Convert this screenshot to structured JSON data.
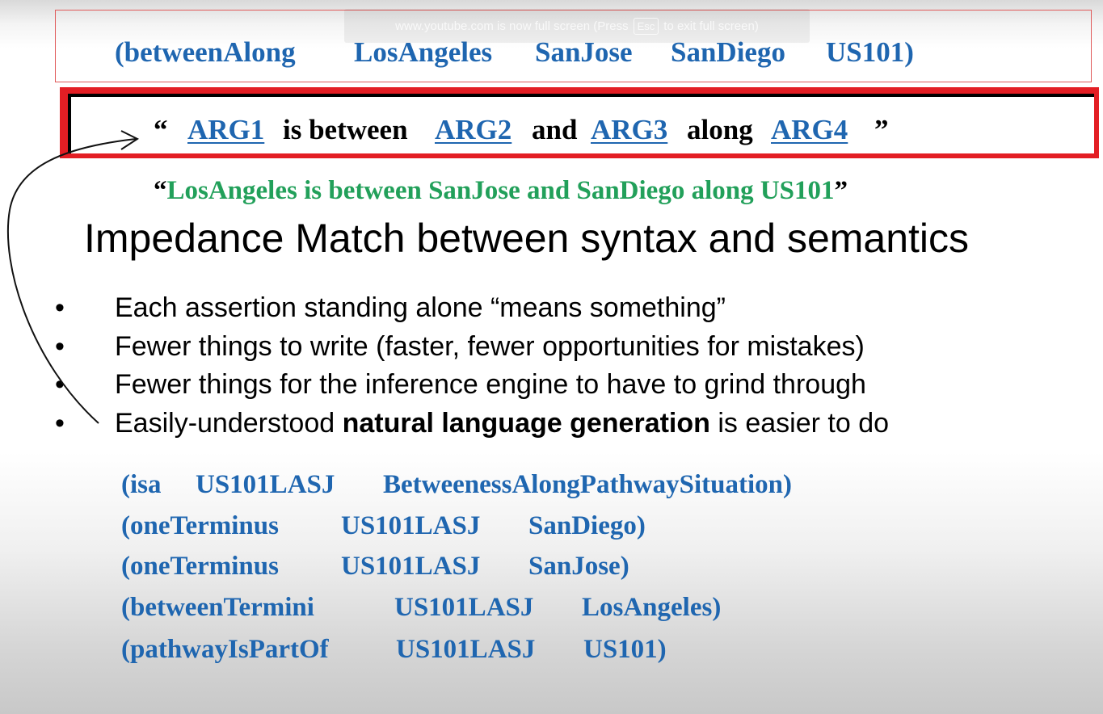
{
  "top_expression": {
    "tokens": [
      "(betweenAlong",
      "LosAngeles",
      "SanJose",
      "SanDiego",
      "US101)"
    ]
  },
  "fullscreen_notice": {
    "before": "www.youtube.com is now full screen (Press",
    "key": "Esc",
    "after": "to exit full screen)"
  },
  "template": {
    "open_quote": "“",
    "arg1": "ARG1",
    "text1": "is between",
    "arg2": "ARG2",
    "text2": "and",
    "arg3": "ARG3",
    "text3": "along",
    "arg4": "ARG4",
    "close_quote": "”"
  },
  "gloss": {
    "open_quote": "“",
    "text": "LosAngeles is between SanJose and SanDiego along US101",
    "close_quote": "”"
  },
  "heading": "Impedance Match between syntax and semantics",
  "bullets": [
    {
      "text": "Each assertion standing alone “means something”"
    },
    {
      "text": "Fewer things to write  (faster, fewer opportunities for mistakes)"
    },
    {
      "text": "Fewer things for the inference engine to have to grind through"
    },
    {
      "pre": "Easily-understood ",
      "bold": "natural language generation",
      "post": " is easier to do"
    }
  ],
  "bullet_glyph": "•",
  "axioms": [
    [
      "(isa",
      "US101LASJ",
      "BetweenessAlongPathwaySituation)"
    ],
    [
      "(oneTerminus",
      "US101LASJ",
      "SanDiego)"
    ],
    [
      "(oneTerminus",
      "US101LASJ",
      "SanJose)"
    ],
    [
      "(betweenTermini",
      "US101LASJ",
      "LosAngeles)"
    ],
    [
      "(pathwayIsPartOf",
      "US101LASJ",
      "US101)"
    ]
  ],
  "colors": {
    "term_blue": "#1f66b0",
    "gloss_green": "#22a05a",
    "frame_red": "#e31e24"
  }
}
